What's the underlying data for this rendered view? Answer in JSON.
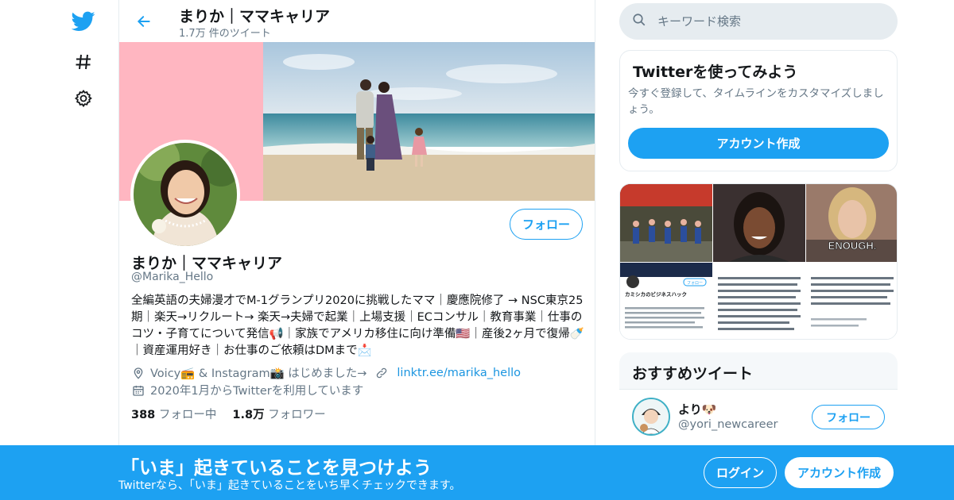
{
  "colors": {
    "accent": "#1da1f2",
    "banner_pink": "#ffb6c1",
    "muted": "#657786",
    "link": "#1b95e0"
  },
  "nav": {
    "icons": [
      "twitter-bird-icon",
      "hashtag-icon",
      "gear-icon"
    ]
  },
  "header": {
    "name": "まりか｜ママキャリア",
    "tweet_count": "1.7万 件のツイート"
  },
  "profile": {
    "follow_label": "フォロー",
    "name": "まりか｜ママキャリア",
    "handle": "@Marika_Hello",
    "bio": "全編英語の夫婦漫才でM-1グランプリ2020に挑戦したママ｜慶應院修了 → NSC東京25期｜楽天→リクルート→ 楽天→夫婦で起業｜上場支援｜ECコンサル｜教育事業｜仕事のコツ・子育てについて発信📢｜家族でアメリカ移住に向け準備🇺🇸｜産後2ヶ月で復帰🍼｜資産運用好き｜お仕事のご依頼はDMまで📩",
    "location": "Voicy📻 & Instagram📸 はじめました→",
    "url": "linktr.ee/marika_hello",
    "joined": "2020年1月からTwitterを利用しています",
    "following_count": "388",
    "following_label": "フォロー中",
    "followers_count": "1.8万",
    "followers_label": "フォロワー"
  },
  "search": {
    "placeholder": "キーワード検索"
  },
  "signup_card": {
    "title": "Twitterを使ってみよう",
    "description": "今すぐ登録して、タイムラインをカスタマイズしましょう。",
    "button": "アカウント作成"
  },
  "media": {
    "enough_text": "ENOUGH.",
    "card_title": "カミシカのビジネスハック",
    "card_follow": "フォロー"
  },
  "recommended": {
    "title": "おすすめツイート",
    "user_name": "より🐶",
    "user_handle": "@yori_newcareer",
    "follow_label": "フォロー"
  },
  "bottom_bar": {
    "title": "「いま」起きていることを見つけよう",
    "subtitle": "Twitterなら、「いま」起きていることをいち早くチェックできます。",
    "login": "ログイン",
    "signup": "アカウント作成"
  }
}
